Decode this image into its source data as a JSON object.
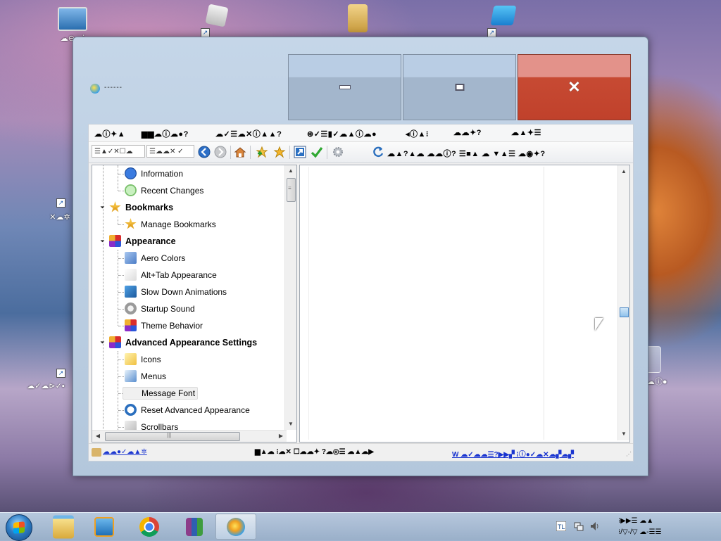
{
  "desktop": {
    "icons": [
      {
        "name": "computer",
        "label": "☁⊖☁ⅰ"
      },
      {
        "name": "recycle-area-left",
        "label": "✕☁✲"
      },
      {
        "name": "shortcut-left-low",
        "label": "☁✓☁⊳✓▪"
      },
      {
        "name": "shortcut-right-low",
        "label": "▪☁ⓘ●"
      }
    ]
  },
  "window": {
    "title": "------",
    "menu": [
      "☁ⓘ✦▲",
      "▆▆☁ⓘ☁●?",
      "☁✓☰☁✕ⓘ▲▲?",
      "⊛✓☰▮✓☁▲ⓘ☁●",
      "◂ⓘ▲⁝",
      "☁☁✦?",
      "☁▲✦☰"
    ],
    "toolbar": {
      "search_box": "☰▲✓✕☐☁",
      "filter_box": "☰☁☁✕ ✓",
      "description": "☁▲?▲☁ ☁☁ⓘ? ☰■▲ ☁ ▼▲☰ ☁◉✦?"
    },
    "tree": [
      {
        "label": "Information",
        "level": 1,
        "icon": "info-icon",
        "kind": "item"
      },
      {
        "label": "Recent Changes",
        "level": 1,
        "icon": "recent-changes-icon",
        "kind": "item"
      },
      {
        "label": "Bookmarks",
        "level": 0,
        "icon": "star-icon",
        "kind": "cat"
      },
      {
        "label": "Manage Bookmarks",
        "level": 1,
        "icon": "manage-bookmarks-icon",
        "kind": "item"
      },
      {
        "label": "Appearance",
        "level": 0,
        "icon": "appearance-icon",
        "kind": "cat"
      },
      {
        "label": "Aero Colors",
        "level": 1,
        "icon": "aero-colors-icon",
        "kind": "item"
      },
      {
        "label": "Alt+Tab Appearance",
        "level": 1,
        "icon": "alt-tab-icon",
        "kind": "item"
      },
      {
        "label": "Slow Down Animations",
        "level": 1,
        "icon": "animations-icon",
        "kind": "item"
      },
      {
        "label": "Startup Sound",
        "level": 1,
        "icon": "sound-icon",
        "kind": "item"
      },
      {
        "label": "Theme Behavior",
        "level": 1,
        "icon": "theme-icon",
        "kind": "item"
      },
      {
        "label": "Advanced Appearance Settings",
        "level": 0,
        "icon": "appearance-icon",
        "kind": "cat"
      },
      {
        "label": "Icons",
        "level": 1,
        "icon": "icons-icon",
        "kind": "item"
      },
      {
        "label": "Menus",
        "level": 1,
        "icon": "menus-icon",
        "kind": "item"
      },
      {
        "label": "Message Font",
        "level": 1,
        "icon": "warning-icon",
        "kind": "item",
        "selected": true
      },
      {
        "label": "Reset Advanced Appearance",
        "level": 1,
        "icon": "reset-icon",
        "kind": "item"
      },
      {
        "label": "Scrollbars",
        "level": 1,
        "icon": "scrollbars-icon",
        "kind": "item"
      }
    ],
    "status": {
      "left": "☁☁●✓☁▲✲",
      "middle": "▆▲☁ ⁝☁✕ ☐☁☁✦ ?☁◎☰ ☁▲☁▶",
      "link": "W ☁✓☁☁☰?▶▶▞ ⁝ⓘ●✓☁✕☁▞☁▞"
    }
  },
  "taskbar": {
    "apps": [
      "explorer",
      "media-player",
      "chrome",
      "archive",
      "tweaker"
    ],
    "clock": {
      "line1": "⁝▶▶☰ ☁▲",
      "line2": "⁝/▽-/▽ ☁-☰☰"
    }
  }
}
